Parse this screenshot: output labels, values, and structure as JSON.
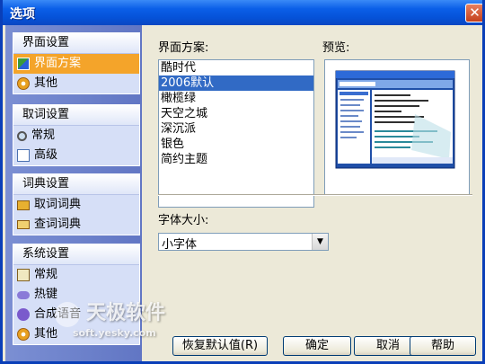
{
  "window": {
    "title": "选项",
    "close_glyph": "✕"
  },
  "sidebar": {
    "groups": [
      {
        "header": "界面设置",
        "items": [
          {
            "label": "界面方案",
            "icon": "palette-icon",
            "selected": true
          },
          {
            "label": "其他",
            "icon": "gear-icon",
            "selected": false
          }
        ]
      },
      {
        "header": "取词设置",
        "items": [
          {
            "label": "常规",
            "icon": "magnifier-icon"
          },
          {
            "label": "高级",
            "icon": "advanced-icon"
          }
        ]
      },
      {
        "header": "词典设置",
        "items": [
          {
            "label": "取词词典",
            "icon": "book-icon"
          },
          {
            "label": "查词词典",
            "icon": "open-book-icon"
          }
        ]
      },
      {
        "header": "系统设置",
        "items": [
          {
            "label": "常规",
            "icon": "system-icon"
          },
          {
            "label": "热键",
            "icon": "key-icon"
          },
          {
            "label": "合成语音",
            "icon": "speech-icon"
          },
          {
            "label": "其他",
            "icon": "gear-icon"
          }
        ]
      }
    ]
  },
  "main": {
    "scheme_label": "界面方案:",
    "preview_label": "预览:",
    "schemes": [
      "酷时代",
      "2006默认",
      "橄榄绿",
      "天空之城",
      "深沉派",
      "银色",
      "简约主题"
    ],
    "selected_scheme_index": 1,
    "font_size_label": "字体大小:",
    "font_size_value": "小字体"
  },
  "buttons": {
    "restore_default": "恢复默认值(R)",
    "ok": "确定",
    "cancel": "取消",
    "help": "帮助"
  },
  "watermark": {
    "main": "天极软件",
    "sub": "soft.yesky.com"
  },
  "colors": {
    "selection_orange": "#f4a42a",
    "list_selection": "#316ac5",
    "title_blue": "#0b5fe8"
  }
}
